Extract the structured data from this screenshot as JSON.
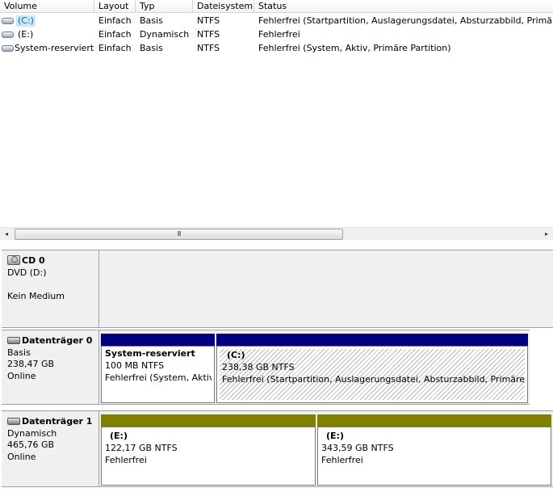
{
  "volume_table": {
    "columns": [
      "Volume",
      "Layout",
      "Typ",
      "Dateisystem",
      "Status"
    ],
    "rows": [
      {
        "volume": "(C:)",
        "layout": "Einfach",
        "typ": "Basis",
        "dateisystem": "NTFS",
        "status": "Fehlerfrei (Startpartition, Auslagerungsdatei, Absturzabbild, Primäre Pa"
      },
      {
        "volume": "(E:)",
        "layout": "Einfach",
        "typ": "Dynamisch",
        "dateisystem": "NTFS",
        "status": "Fehlerfrei"
      },
      {
        "volume": "System-reserviert",
        "layout": "Einfach",
        "typ": "Basis",
        "dateisystem": "NTFS",
        "status": "Fehlerfrei (System, Aktiv, Primäre Partition)"
      }
    ],
    "selected_row": 0
  },
  "scrollbar": {
    "left_arrow": "◂",
    "right_arrow": "▸",
    "thumb_grip": "III"
  },
  "disks": [
    {
      "name": "CD 0",
      "lines": [
        "DVD (D:)",
        "",
        "Kein Medium"
      ],
      "icon": "cd-drive-icon",
      "partitions": []
    },
    {
      "name": "Datenträger 0",
      "lines": [
        "Basis",
        "238,47 GB",
        "Online"
      ],
      "icon": "hard-disk-icon",
      "partitions": [
        {
          "name": "System-reserviert",
          "size": "100 MB NTFS",
          "status": "Fehlerfrei (System, Aktiv",
          "bar_color": "#000080"
        },
        {
          "name": "(C:)",
          "size": "238,38 GB NTFS",
          "status": "Fehlerfrei (Startpartition, Auslagerungsdatei, Absturzabbild, Primäre Pa",
          "bar_color": "#000080",
          "selected": true
        }
      ]
    },
    {
      "name": "Datenträger 1",
      "lines": [
        "Dynamisch",
        "465,76 GB",
        "Online"
      ],
      "icon": "hard-disk-icon",
      "partitions": [
        {
          "name": "(E:)",
          "size": "122,17 GB NTFS",
          "status": "Fehlerfrei",
          "bar_color": "#808000"
        },
        {
          "name": "(E:)",
          "size": "343,59 GB NTFS",
          "status": "Fehlerfrei",
          "bar_color": "#808000"
        }
      ]
    }
  ]
}
